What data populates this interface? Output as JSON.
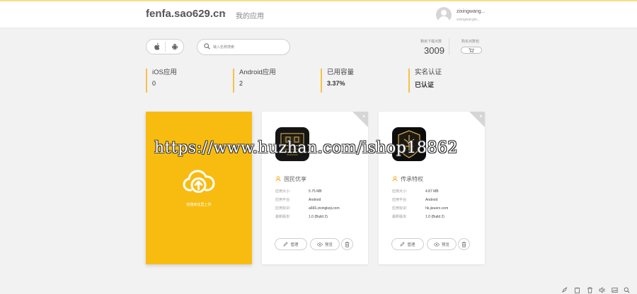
{
  "header": {
    "brand": "fenfa.sao629.cn",
    "breadcrumb_separator": "›",
    "breadcrumb": "我的应用",
    "user": {
      "name": "zixingwang...",
      "sub": "zixingwangla..."
    }
  },
  "toolbar": {
    "platform_icons": [
      "apple-icon",
      "android-icon"
    ],
    "search_placeholder": "输入名称搜索",
    "download_label": "剩余下载点数",
    "download_count": "3009",
    "buy_label": "购买点数包"
  },
  "stats": [
    {
      "label": "iOS应用",
      "value": "0",
      "strong": false
    },
    {
      "label": "Android应用",
      "value": "2",
      "strong": false
    },
    {
      "label": "已用容量",
      "value": "3.37%",
      "strong": true
    },
    {
      "label": "实名认证",
      "value": "已认证",
      "strong": true
    }
  ],
  "upload": {
    "text": "拖拽到这里上传",
    "icon": "cloud-upload-icon"
  },
  "field_labels": {
    "size": "应用大小:",
    "platform": "应用平台:",
    "bundle": "应用标识:",
    "version": "最新版本:"
  },
  "apps": [
    {
      "name": "国民优享",
      "size": "5.75 MB",
      "platform": "Android",
      "bundle": "a666.zixingkeji.com",
      "version": "1.0  (Build 2)",
      "manage": "管理",
      "preview": "预览"
    },
    {
      "name": "传承特权",
      "size": "4.87 MB",
      "platform": "Android",
      "bundle": "hk.jieuerx.com",
      "version": "1.0  (Build 2)",
      "manage": "管理",
      "preview": "预览"
    }
  ],
  "watermark": "https://www.huzhan.com/ishop18862",
  "colors": {
    "accent": "#f8bc11",
    "stat_border": "#f6c145",
    "background": "#f2f2f2"
  }
}
